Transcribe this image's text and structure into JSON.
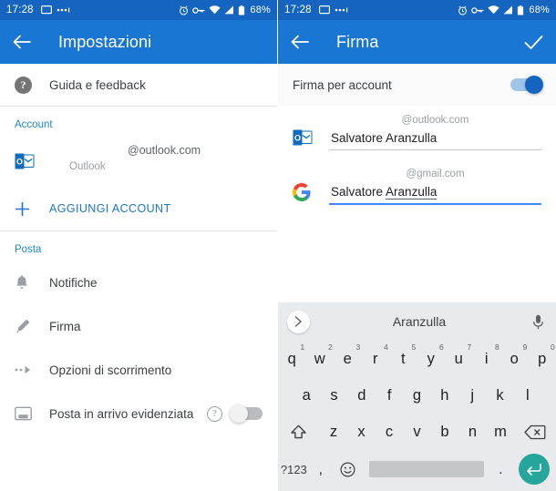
{
  "left": {
    "statusbar": {
      "time": "17:28",
      "battery": "68%",
      "icons": [
        "cast-icon",
        "more-dots-icon",
        "alarm-icon",
        "vpn-key-icon",
        "wifi-icon",
        "signal-icon",
        "battery-icon"
      ]
    },
    "appbar": {
      "title": "Impostazioni",
      "back": "back-arrow-icon"
    },
    "help_row": {
      "label": "Guida e feedback",
      "icon": "help-circle-icon"
    },
    "sections": [
      {
        "header": "Account",
        "items": [
          {
            "type": "account",
            "icon": "outlook-icon",
            "email": "@outlook.com",
            "provider": "Outlook"
          },
          {
            "type": "action",
            "icon": "plus-icon",
            "label": "AGGIUNGI ACCOUNT"
          }
        ]
      },
      {
        "header": "Posta",
        "items": [
          {
            "type": "nav",
            "icon": "bell-icon",
            "label": "Notifiche"
          },
          {
            "type": "nav",
            "icon": "pen-icon",
            "label": "Firma"
          },
          {
            "type": "nav",
            "icon": "swipe-options-icon",
            "label": "Opzioni di scorrimento"
          },
          {
            "type": "toggle",
            "icon": "inbox-icon",
            "label": "Posta in arrivo evidenziata",
            "help": "?",
            "state": "off"
          }
        ]
      }
    ]
  },
  "right": {
    "statusbar": {
      "time": "17:28",
      "battery": "68%"
    },
    "appbar": {
      "title": "Firma",
      "back": "back-arrow-icon",
      "confirm": "checkmark-icon"
    },
    "per_account": {
      "label": "Firma per account",
      "state": "on"
    },
    "signatures": [
      {
        "icon": "outlook-icon",
        "domain": "@outlook.com",
        "value": "Salvatore Aranzulla",
        "focused": false
      },
      {
        "icon": "google-icon",
        "domain": "@gmail.com",
        "value": "Salvatore ",
        "spell_word": "Aranzulla",
        "focused": true
      }
    ],
    "keyboard": {
      "suggestion": "Aranzulla",
      "chevron": "chevron-right-icon",
      "mic": "microphone-icon",
      "row1": [
        {
          "k": "q",
          "n": "1"
        },
        {
          "k": "w",
          "n": "2"
        },
        {
          "k": "e",
          "n": "3"
        },
        {
          "k": "r",
          "n": "4"
        },
        {
          "k": "t",
          "n": "5"
        },
        {
          "k": "y",
          "n": "6"
        },
        {
          "k": "u",
          "n": "7"
        },
        {
          "k": "i",
          "n": "8"
        },
        {
          "k": "o",
          "n": "9"
        },
        {
          "k": "p",
          "n": "0"
        }
      ],
      "row2": [
        "a",
        "s",
        "d",
        "f",
        "g",
        "h",
        "j",
        "k",
        "l"
      ],
      "row3": [
        "z",
        "x",
        "c",
        "v",
        "b",
        "n",
        "m"
      ],
      "shift": "shift-icon",
      "backspace": "backspace-icon",
      "symbols": "?123",
      "comma": ",",
      "emoji": "emoji-icon",
      "period": ".",
      "enter": "enter-icon"
    }
  }
}
